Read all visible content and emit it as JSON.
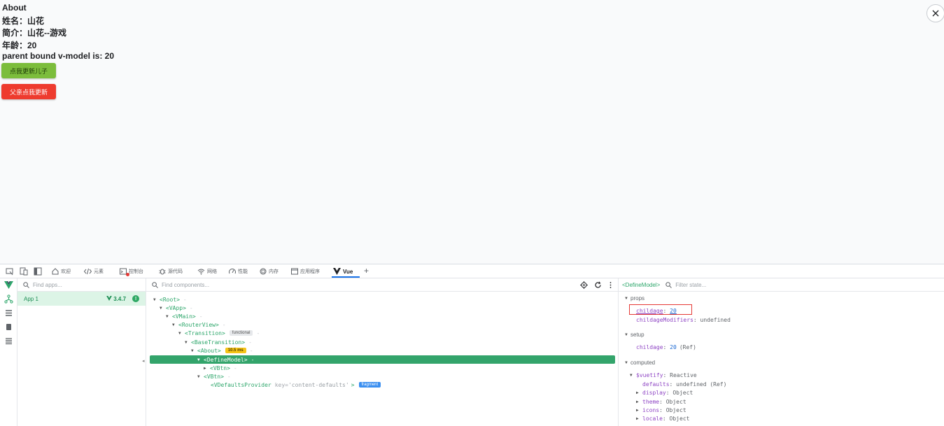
{
  "page": {
    "lines": [
      "About",
      "姓名：山花",
      "简介：山花--游戏",
      "年龄：20",
      "parent bound v-model is: 20"
    ],
    "buttons": {
      "update_child": "点我更新儿子",
      "parent_update": "父亲点我更新"
    }
  },
  "devtools": {
    "tabs": [
      "欢迎",
      "元素",
      "控制台",
      "源代码",
      "网络",
      "性能",
      "内存",
      "应用程序",
      "Vue"
    ],
    "add_tab": "+",
    "apps_search_placeholder": "Find apps...",
    "app": {
      "name": "App 1",
      "version": "3.4.7"
    },
    "components_search_placeholder": "Find components...",
    "tree": [
      {
        "label": "<Root>"
      },
      {
        "label": "<VApp>"
      },
      {
        "label": "<VMain>"
      },
      {
        "label": "<RouterView>"
      },
      {
        "label": "<Transition>",
        "badge": "functional"
      },
      {
        "label": "<BaseTransition>"
      },
      {
        "label": "<About>",
        "badge": "10.5 ms"
      },
      {
        "label": "<DefineModel>"
      },
      {
        "label": "<VBtn>"
      },
      {
        "label": "<VBtn>"
      },
      {
        "label": "<VDefaultsProvider",
        "attr_key": "key=",
        "attr_val": "'content-defaults'",
        "close": ">",
        "badge": "fragment"
      }
    ],
    "state": {
      "component": "<DefineModel>",
      "filter_placeholder": "Filter state...",
      "sections": {
        "props": "props",
        "setup": "setup",
        "computed": "computed"
      },
      "props": [
        {
          "key": "childage",
          "value": "20"
        },
        {
          "key": "childageModifiers",
          "value": "undefined"
        }
      ],
      "setup": [
        {
          "key": "childage",
          "value": "20",
          "note": "(Ref)"
        }
      ],
      "computed": {
        "vuetify": {
          "key": "$vuetify",
          "value": "Reactive"
        },
        "items": [
          {
            "key": "defaults",
            "value": "undefined (Ref)"
          },
          {
            "key": "display",
            "value": "Object"
          },
          {
            "key": "theme",
            "value": "Object"
          },
          {
            "key": "icons",
            "value": "Object"
          },
          {
            "key": "locale",
            "value": "Object"
          }
        ]
      }
    }
  },
  "colors": {
    "vue_green": "#2ca66a",
    "selected_row": "#33a46b",
    "button_green": "#7cbd3c",
    "button_red": "#ee3b2e",
    "highlight_red": "#e53935"
  }
}
